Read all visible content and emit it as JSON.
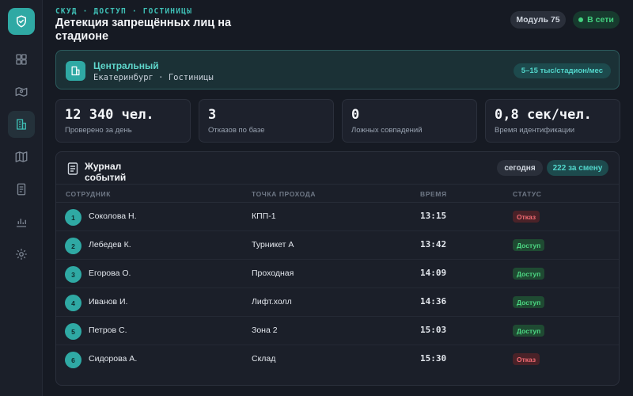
{
  "header": {
    "breadcrumb": "СКУД · ДОСТУП · ГОСТИНИЦЫ",
    "title": "Детекция запрещённых лиц на стадионе",
    "module": "Модуль 75",
    "status": "В сети"
  },
  "sidebar": {
    "items": [
      {
        "icon": "dashboard-icon"
      },
      {
        "icon": "map-pin-icon"
      },
      {
        "icon": "building-icon",
        "active": true
      },
      {
        "icon": "map-icon"
      },
      {
        "icon": "document-icon"
      },
      {
        "icon": "bar-chart-icon"
      },
      {
        "icon": "gear-icon"
      }
    ]
  },
  "location": {
    "name": "Центральный",
    "subtitle": "Екатеринбург · Гостиницы",
    "range": "5–15 тыс/стадион/мес"
  },
  "stats": [
    {
      "value": "12 340 чел.",
      "label": "Проверено за день"
    },
    {
      "value": "3",
      "label": "Отказов по базе"
    },
    {
      "value": "0",
      "label": "Ложных совпадений"
    },
    {
      "value": "0,8 сек/чел.",
      "label": "Время идентификации"
    }
  ],
  "journal": {
    "title": "Журнал событий",
    "today": "сегодня",
    "count": "222 за смену",
    "columns": [
      "СОТРУДНИК",
      "ТОЧКА ПРОХОДА",
      "ВРЕМЯ",
      "СТАТУС"
    ],
    "rows": [
      {
        "n": "1",
        "employee": "Соколова Н.",
        "point": "КПП-1",
        "time": "13:15",
        "status": "Отказ",
        "kind": "deny"
      },
      {
        "n": "2",
        "employee": "Лебедев К.",
        "point": "Турникет А",
        "time": "13:42",
        "status": "Доступ",
        "kind": "ok"
      },
      {
        "n": "3",
        "employee": "Егорова О.",
        "point": "Проходная",
        "time": "14:09",
        "status": "Доступ",
        "kind": "ok"
      },
      {
        "n": "4",
        "employee": "Иванов И.",
        "point": "Лифт.холл",
        "time": "14:36",
        "status": "Доступ",
        "kind": "ok"
      },
      {
        "n": "5",
        "employee": "Петров С.",
        "point": "Зона 2",
        "time": "15:03",
        "status": "Доступ",
        "kind": "ok"
      },
      {
        "n": "6",
        "employee": "Сидорова А.",
        "point": "Склад",
        "time": "15:30",
        "status": "Отказ",
        "kind": "deny"
      }
    ]
  },
  "colors": {
    "accent": "#2fa9a4",
    "ok": "#4cd682",
    "deny": "#f26b73"
  }
}
